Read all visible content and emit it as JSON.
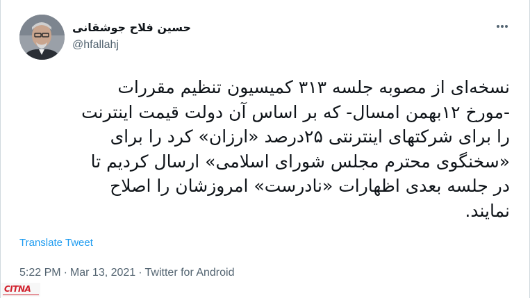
{
  "tweet": {
    "author_name": "حسین فلاح جوشقانی",
    "author_handle": "@hfallahj",
    "text": "نسخه‌ای از مصوبه جلسه ۳۱۳ کمیسیون تنظیم مقررات\n-مورخ ۱۲بهمن امسال- که بر اساس آن دولت قیمت اینترنت\nرا برای شرکتهای اینترنتی ۲۵درصد «ارزان» کرد را برای\n«سخنگوی محترم مجلس شورای اسلامی» ارسال کردیم تا\nدر جلسه بعدی اظهارات «نادرست» امروزشان را اصلاح\nنمایند.",
    "translate_label": "Translate Tweet",
    "time": "5:22 PM",
    "date": "Mar 13, 2021",
    "source": "Twitter for Android",
    "separator": "·"
  },
  "icons": {
    "more": "more-options-icon",
    "avatar": "avatar"
  },
  "watermark": {
    "text": "CITNA"
  },
  "colors": {
    "link": "#1d9bf0",
    "text": "#0f1419",
    "secondary": "#536471",
    "watermark": "#d11f2b"
  }
}
